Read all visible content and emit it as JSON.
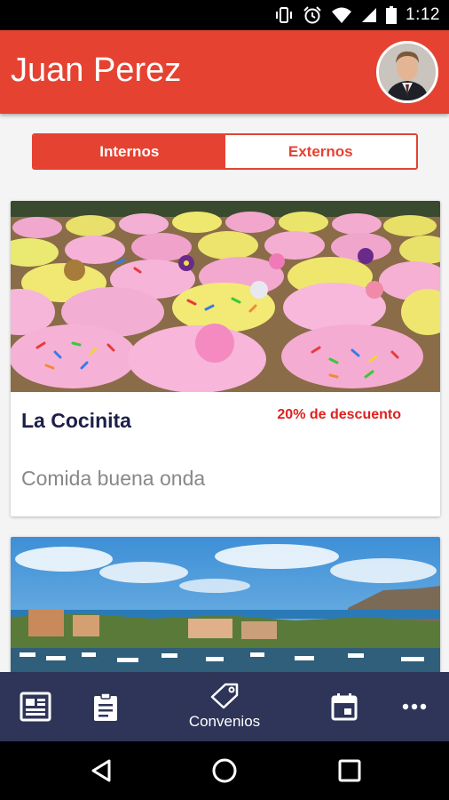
{
  "status_bar": {
    "time": "1:12",
    "icons": [
      "vibrate-icon",
      "alarm-icon",
      "wifi-icon",
      "signal-icon",
      "battery-icon"
    ]
  },
  "header": {
    "title": "Juan Perez",
    "avatar_icon": "avatar",
    "background_color": "#e64232"
  },
  "tabs": [
    {
      "label": "Internos",
      "active": true
    },
    {
      "label": "Externos",
      "active": false
    }
  ],
  "cards": [
    {
      "image": "cupcakes-photo",
      "name": "La Cocinita",
      "discount": "20% de descuento",
      "description": "Comida buena onda"
    },
    {
      "image": "marina-photo",
      "name": "",
      "discount": "",
      "description": ""
    }
  ],
  "bottom_nav": {
    "items": [
      {
        "icon": "newspaper-icon",
        "label": ""
      },
      {
        "icon": "clipboard-icon",
        "label": ""
      },
      {
        "icon": "tag-icon",
        "label": "Convenios"
      },
      {
        "icon": "calendar-icon",
        "label": ""
      },
      {
        "icon": "more-icon",
        "label": ""
      }
    ],
    "background_color": "#2e3558"
  },
  "system_nav": {
    "icons": [
      "back-icon",
      "home-icon",
      "recents-icon"
    ]
  }
}
